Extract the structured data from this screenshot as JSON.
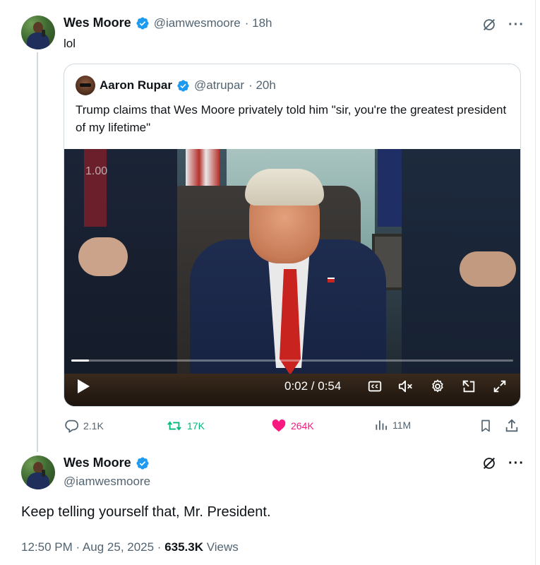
{
  "colors": {
    "verified": "#1d9bf0",
    "text_primary": "#0f1419",
    "text_secondary": "#536471",
    "retweet": "#00ba7c",
    "like": "#f91880"
  },
  "tweet": {
    "author_name": "Wes Moore",
    "author_handle": "@iamwesmoore",
    "time": "· 18h",
    "text": "lol"
  },
  "quote": {
    "author_name": "Aaron Rupar",
    "author_handle": "@atrupar",
    "time": "· 20h",
    "text": "Trump claims that Wes Moore privately told him \"sir, you're the greatest president of my lifetime\"",
    "video": {
      "playback_rate": "1.00",
      "time_display": "0:02 / 0:54",
      "progress_fraction": 0.04
    }
  },
  "actions": {
    "replies": "2.1K",
    "retweets": "17K",
    "likes": "264K",
    "views": "11M"
  },
  "reply": {
    "author_name": "Wes Moore",
    "author_handle": "@iamwesmoore",
    "text": "Keep telling yourself that, Mr. President.",
    "timestamp": "12:50 PM · Aug 25, 2025 · ",
    "views_count": "635.3K",
    "views_label": " Views"
  },
  "icons": [
    "verified-icon",
    "grok-icon",
    "more-icon",
    "play-icon",
    "captions-icon",
    "mute-icon",
    "settings-icon",
    "popout-icon",
    "fullscreen-icon",
    "reply-icon",
    "retweet-icon",
    "like-icon",
    "views-icon",
    "bookmark-icon",
    "share-icon"
  ]
}
